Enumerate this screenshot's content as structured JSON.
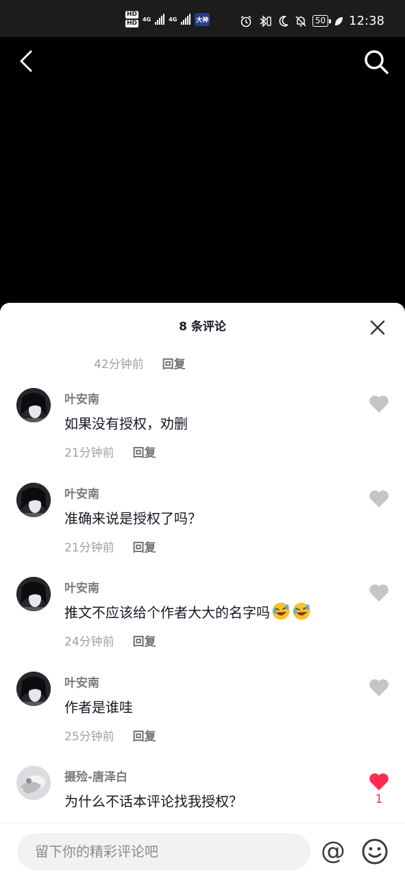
{
  "status_bar": {
    "hd1": "HD",
    "hd2": "HD",
    "net1": "4G",
    "net2": "4G",
    "badge": "大神",
    "battery": "50",
    "time": "12:38"
  },
  "nav": {
    "back_icon": "chevron-left-icon",
    "search_icon": "search-icon"
  },
  "sheet": {
    "title": "8 条评论",
    "close_icon": "close-icon",
    "partial": {
      "time": "42分钟前",
      "reply": "回复"
    },
    "comments": [
      {
        "name": "叶安南",
        "text": "如果没有授权，劝删",
        "time": "21分钟前",
        "reply": "回复",
        "liked": false
      },
      {
        "name": "叶安南",
        "text": "准确来说是授权了吗？",
        "time": "21分钟前",
        "reply": "回复",
        "liked": false
      },
      {
        "name": "叶安南",
        "text": "推文不应该给个作者大大的名字吗",
        "emoji": "rolling-laughing-emoji",
        "time": "24分钟前",
        "reply": "回复",
        "liked": false
      },
      {
        "name": "叶安南",
        "text": "作者是谁哇",
        "time": "25分钟前",
        "reply": "回复",
        "liked": false
      },
      {
        "name": "摄殓-唐泽白",
        "text": "为什么不话本评论找我授权？",
        "liked": true,
        "like_count": "1"
      }
    ]
  },
  "input": {
    "placeholder": "留下你的精彩评论吧",
    "at_label": "@",
    "emoji_icon": "smiley-icon"
  },
  "colors": {
    "accent_like": "#fe2c55",
    "unliked_heart": "#c5c5c8",
    "text_primary": "#161823"
  }
}
